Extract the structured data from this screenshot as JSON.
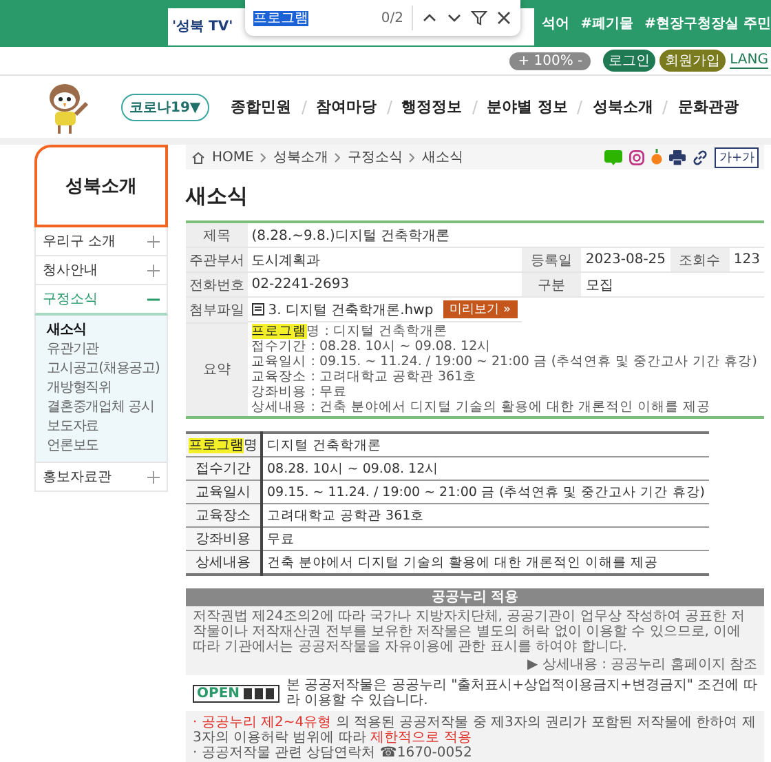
{
  "top_bar": {
    "search_value": "'성북 TV'",
    "hashtags": [
      "석어",
      "#폐기물",
      "#현장구청장실 주민"
    ]
  },
  "find_bar": {
    "value": "프로그램",
    "count": "0/2"
  },
  "utility": {
    "zoom": "+ 100% -",
    "buttons": [
      "로그인",
      "회원가입"
    ],
    "language": "LANG"
  },
  "header": {
    "covid_button": "코로나19▼",
    "nav": [
      "종합민원",
      "참여마당",
      "행정정보",
      "분야별 정보",
      "성북소개",
      "문화관광"
    ]
  },
  "sidebar": {
    "title": "성북소개",
    "items": [
      {
        "label": "우리구 소개",
        "expanded": false
      },
      {
        "label": "청사안내",
        "expanded": false
      },
      {
        "label": "구정소식",
        "expanded": true,
        "children": [
          {
            "label": "새소식",
            "selected": true
          },
          {
            "label": "유관기관",
            "selected": false
          },
          {
            "label": "고시공고(채용공고)",
            "selected": false
          },
          {
            "label": "개방형직위",
            "selected": false
          },
          {
            "label": "결혼중개업체 공시",
            "selected": false
          },
          {
            "label": "보도자료",
            "selected": false
          },
          {
            "label": "언론보도",
            "selected": false
          }
        ]
      },
      {
        "label": "홍보자료관",
        "expanded": false
      }
    ]
  },
  "breadcrumb": [
    "HOME",
    "성북소개",
    "구정소식",
    "새소식"
  ],
  "font_button": "가+가",
  "page_title": "새소식",
  "info": [
    {
      "kind": "text",
      "cells": [
        [
          "제목",
          "(8.28.~9.8.)디지털 건축학개론"
        ]
      ]
    },
    {
      "kind": "text",
      "cells": [
        [
          "주관부서",
          "도시계획과"
        ],
        [
          "등록일",
          "2023-08-25"
        ],
        [
          "조회수",
          "123"
        ]
      ]
    },
    {
      "kind": "text",
      "cells": [
        [
          "전화번호",
          "02-2241-2693"
        ],
        [
          "구분",
          "모집"
        ]
      ]
    },
    {
      "kind": "file",
      "label": "첨부파일",
      "file": "3. 디지털 건축학개론.hwp",
      "preview": "미리보기 »"
    },
    {
      "kind": "summary",
      "label": "요약",
      "lines": [
        {
          "highlight": "프로그램",
          "text": "명 : 디지털 건축학개론"
        },
        {
          "text": "접수기간 : 08.28. 10시 ~ 09.08. 12시"
        },
        {
          "text": "교육일시 : 09.15. ~ 11.24. / 19:00 ~ 21:00 금 (추석연휴 및 중간고사 기간 휴강)"
        },
        {
          "text": "교육장소 : 고려대학교 공학관 361호"
        },
        {
          "text": "강좌비용 : 무료"
        },
        {
          "text": "상세내용 : 건축 분야에서 디지털 기술의 활용에 대한 개론적인 이해를 제공"
        }
      ]
    }
  ],
  "program": [
    {
      "highlight": "프로그램",
      "label": "명",
      "value": "디지털 건축학개론"
    },
    {
      "label": "접수기간",
      "value": "08.28. 10시 ~ 09.08. 12시"
    },
    {
      "label": "교육일시",
      "value": "09.15. ~ 11.24. / 19:00 ~ 21:00 금 (추석연휴 및 중간고사 기간 휴강)"
    },
    {
      "label": "교육장소",
      "value": "고려대학교 공학관 361호"
    },
    {
      "label": "강좌비용",
      "value": "무료"
    },
    {
      "label": "상세내용",
      "value": "건축 분야에서 디지털 기술의 활용에 대한 개론적인 이해를 제공"
    }
  ],
  "license": {
    "title": "공공누리 적용",
    "text": "저작권법 제24조의2에 따라 국가나 지방자치단체, 공공기관이 업무상 작성하여 공표한 저작물이나 저작재산권 전부를 보유한 저작물은 별도의 허락 없이 이용할 수 있으므로, 이에 따라 기관에서는 공공저작물을 자유이용에 관한 표시를 하여야 합니다.",
    "detail": "▶ 상세내용 : 공공누리 홈페이지 참조",
    "badge": "OPEN",
    "condition": "본 공공저작물은 공공누리 \"출처표시+상업적이용금지+변경금지\" 조건에 따라 이용할 수 있습니다.",
    "notes": [
      [
        {
          "text": "· 공공누리 제2~4유형",
          "red": true
        },
        {
          "text": " 의 적용된 공공저작물 중 제3자의 권리가 포함된 저작물에 한하여 제3자의 이용허락 범위에 따라 ",
          "red": false
        },
        {
          "text": "제한적으로 적용",
          "red": true
        }
      ],
      [
        {
          "text": "· 공공저작물 관련 상담연락처 ☎1670-0052",
          "red": false
        }
      ]
    ]
  }
}
